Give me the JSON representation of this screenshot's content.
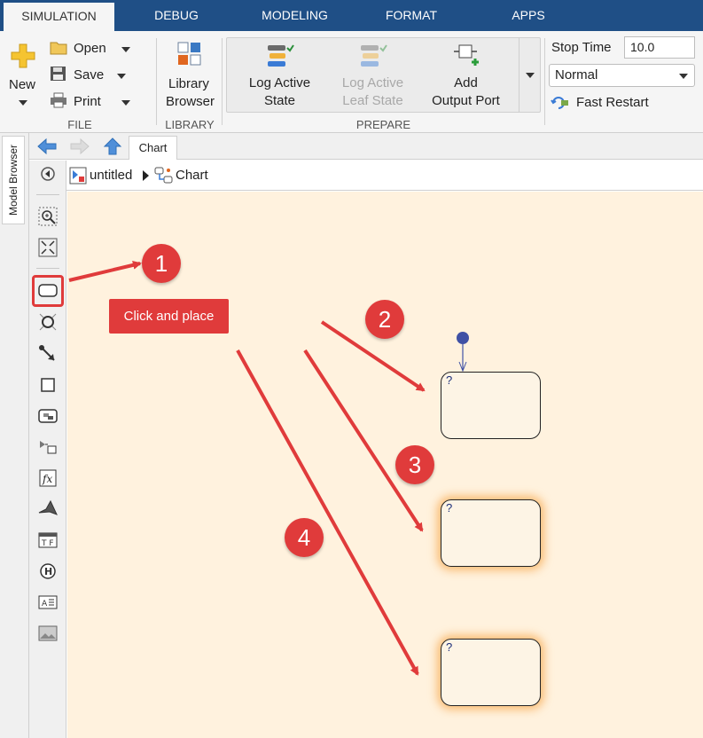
{
  "tabs": [
    "SIMULATION",
    "DEBUG",
    "MODELING",
    "FORMAT",
    "APPS"
  ],
  "ribbon": {
    "file": {
      "new_label": "New",
      "open_label": "Open",
      "save_label": "Save",
      "print_label": "Print",
      "group_label": "FILE"
    },
    "library": {
      "button_label_line1": "Library",
      "button_label_line2": "Browser",
      "group_label": "LIBRARY"
    },
    "prepare": {
      "log_active_state_line1": "Log Active",
      "log_active_state_line2": "State",
      "log_active_leaf_line1": "Log Active",
      "log_active_leaf_line2": "Leaf State",
      "add_output_line1": "Add",
      "add_output_line2": "Output Port",
      "group_label": "PREPARE"
    },
    "simulate": {
      "stop_time_label": "Stop Time",
      "stop_time_value": "10.0",
      "mode_value": "Normal",
      "fast_restart_label": "Fast Restart"
    }
  },
  "model_browser": {
    "label": "Model Browser"
  },
  "nav": {
    "tab_label": "Chart"
  },
  "breadcrumb": {
    "root": "untitled",
    "child": "Chart"
  },
  "canvas": {
    "callout_text": "Click and place",
    "badges": [
      "1",
      "2",
      "3",
      "4"
    ],
    "state_placeholder": "?"
  },
  "colors": {
    "tab_bar": "#1f4f86",
    "accent_red": "#e03b3b",
    "canvas_bg": "#fff2de",
    "state_glow": "#f6a03c",
    "default_transition": "#3f51a5"
  },
  "icons": {
    "new": "plus-icon",
    "open": "folder-icon",
    "save": "floppy-icon",
    "print": "printer-icon",
    "library": "library-grid-icon",
    "log_state": "log-signal-icon",
    "add_port": "output-port-icon",
    "fast_restart": "fast-restart-icon",
    "back": "back-arrow-icon",
    "forward": "forward-arrow-icon",
    "up": "up-arrow-icon"
  }
}
